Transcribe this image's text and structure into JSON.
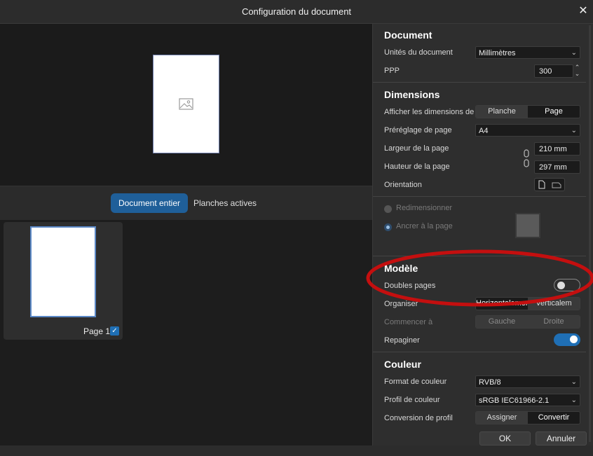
{
  "window": {
    "title": "Configuration du document",
    "close_icon": "close-icon"
  },
  "preview": {
    "image_icon": "image-placeholder-icon"
  },
  "tabs": [
    {
      "label": "Document entier",
      "active": true
    },
    {
      "label": "Planches actives",
      "active": false
    }
  ],
  "thumbnails": [
    {
      "label": "Page 1",
      "checked": true
    }
  ],
  "document": {
    "title": "Document",
    "units_label": "Unités du document",
    "units_value": "Millimètres",
    "ppp_label": "PPP",
    "ppp_value": "300"
  },
  "dimensions": {
    "title": "Dimensions",
    "show_dims_label": "Afficher les dimensions de",
    "show_dims_options": [
      "Planche",
      "Page"
    ],
    "show_dims_selected": "Page",
    "preset_label": "Préréglage de page",
    "preset_value": "A4",
    "width_label": "Largeur de la page",
    "width_value": "210 mm",
    "height_label": "Hauteur de la page",
    "height_value": "297 mm",
    "orientation_label": "Orientation",
    "resize_label": "Redimensionner",
    "anchor_label": "Ancrer à la page"
  },
  "model": {
    "title": "Modèle",
    "double_pages_label": "Doubles pages",
    "double_pages_on": false,
    "organize_label": "Organiser",
    "organize_options": [
      "Horizontalement",
      "Verticalem"
    ],
    "start_label": "Commencer à",
    "start_options": [
      "Gauche",
      "Droite"
    ],
    "repaginate_label": "Repaginer",
    "repaginate_on": true
  },
  "color": {
    "title": "Couleur",
    "format_label": "Format de couleur",
    "format_value": "RVB/8",
    "profile_label": "Profil de couleur",
    "profile_value": "sRGB IEC61966-2.1",
    "conversion_label": "Conversion de profil",
    "conversion_options": [
      "Assigner",
      "Convertir"
    ],
    "conversion_selected": "Convertir"
  },
  "buttons": {
    "ok": "OK",
    "cancel": "Annuler"
  },
  "annotation": {
    "color": "#c40f0f"
  }
}
